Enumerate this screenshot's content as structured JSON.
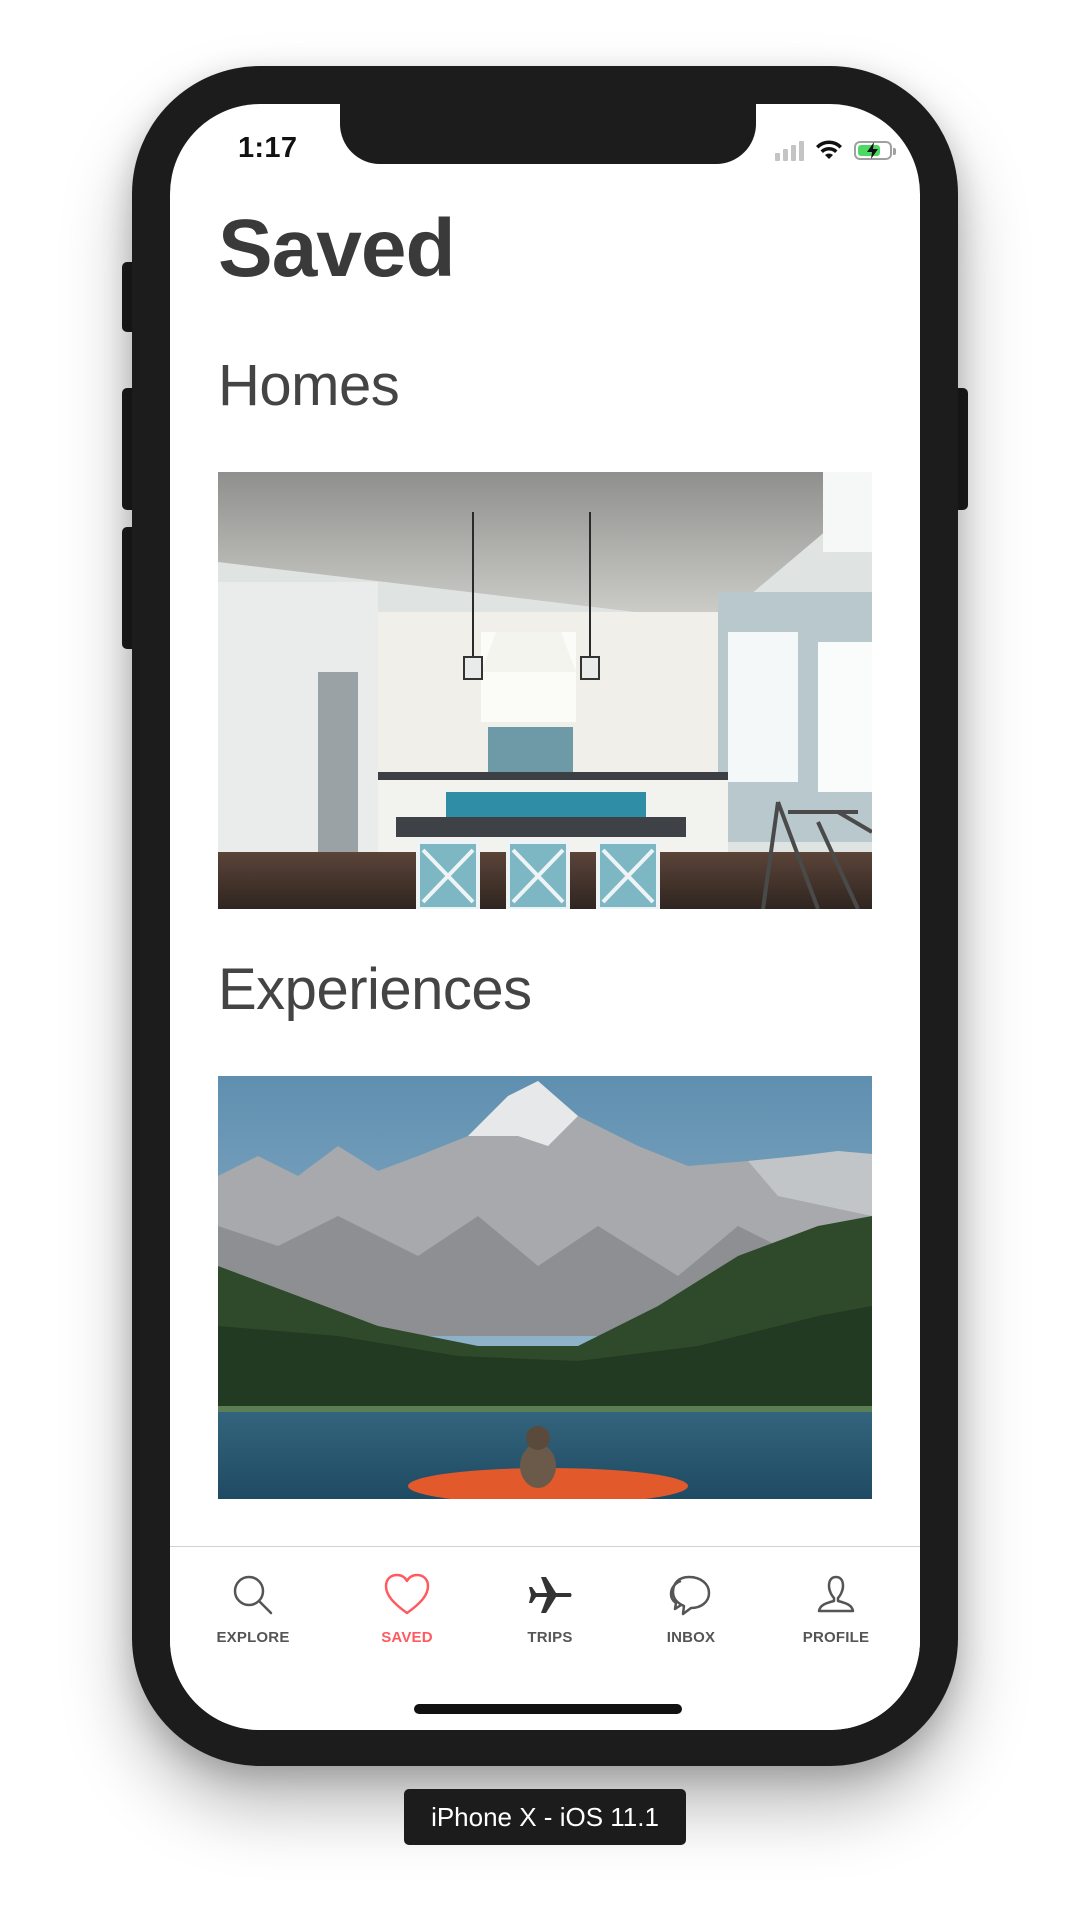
{
  "status_bar": {
    "time": "1:17"
  },
  "page": {
    "title": "Saved"
  },
  "sections": [
    {
      "title": "Homes",
      "image_alt": "Kitchen with white cabinets, pendant lights and a blue island"
    },
    {
      "title": "Experiences",
      "image_alt": "Snowy mountains above a forest and lake with a kayaker"
    }
  ],
  "tabs": [
    {
      "label": "EXPLORE",
      "icon": "search-icon",
      "active": false
    },
    {
      "label": "SAVED",
      "icon": "heart-icon",
      "active": true
    },
    {
      "label": "TRIPS",
      "icon": "airplane-icon",
      "active": false
    },
    {
      "label": "INBOX",
      "icon": "chat-bubbles-icon",
      "active": false
    },
    {
      "label": "PROFILE",
      "icon": "person-icon",
      "active": false
    }
  ],
  "colors": {
    "accent": "#ff5a5f",
    "text": "#3a3a3a",
    "tab_label": "#555555"
  },
  "device_label": "iPhone X - iOS 11.1"
}
